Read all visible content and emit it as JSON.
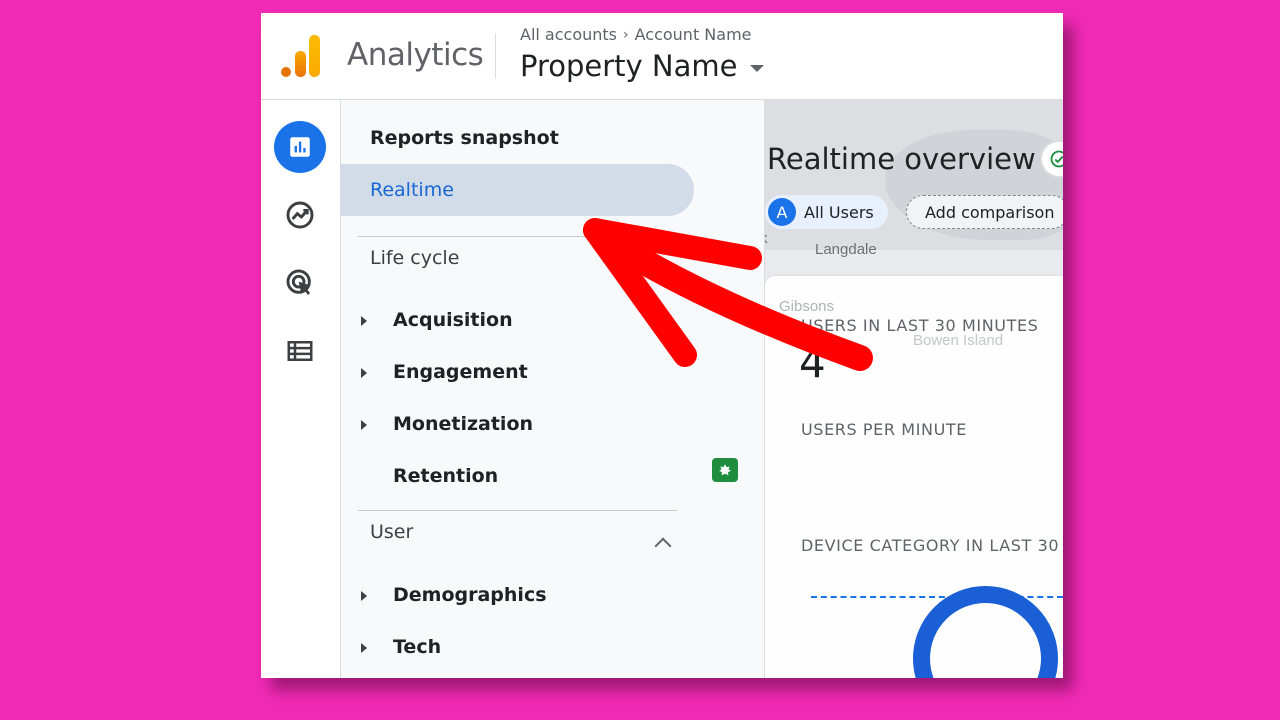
{
  "colors": {
    "background": "#f12ab5",
    "accent": "#1a73e8",
    "active_text": "#1967d2",
    "arrow": "#ff0000"
  },
  "header": {
    "app_title": "Analytics",
    "breadcrumb": {
      "root": "All accounts",
      "account": "Account Name"
    },
    "property_name": "Property Name"
  },
  "rail": {
    "items": [
      {
        "icon": "reports-icon",
        "active": true
      },
      {
        "icon": "explore-icon",
        "active": false
      },
      {
        "icon": "advertising-icon",
        "active": false
      },
      {
        "icon": "configure-icon",
        "active": false
      }
    ]
  },
  "nav": {
    "reports_snapshot": "Reports snapshot",
    "realtime": "Realtime",
    "life_cycle": {
      "title": "Life cycle",
      "items": [
        "Acquisition",
        "Engagement",
        "Monetization",
        "Retention"
      ]
    },
    "user": {
      "title": "User",
      "items": [
        "Demographics",
        "Tech"
      ]
    }
  },
  "main": {
    "title": "Realtime overview",
    "chips": {
      "avatar_letter": "A",
      "all_users": "All Users",
      "add_comparison": "Add comparison"
    },
    "map_labels": [
      "Langdale",
      "Gibsons",
      "Bowen Island",
      "k"
    ],
    "card": {
      "users_30_label": "USERS IN LAST 30 MINUTES",
      "users_30_value": "4",
      "users_per_minute_label": "USERS PER MINUTE",
      "device_category_label": "DEVICE CATEGORY IN LAST 30"
    }
  }
}
